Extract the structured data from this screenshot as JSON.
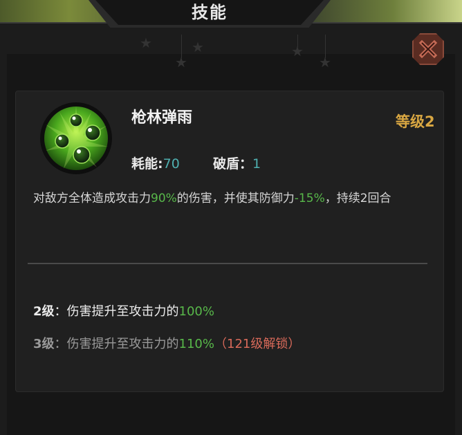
{
  "window": {
    "title": "技能"
  },
  "skill": {
    "name": "枪林弹雨",
    "level_label": "等级2",
    "energy_label": "耗能:",
    "energy_value": "70",
    "break_label": "破盾：",
    "break_value": "1",
    "icon": "green-droplets-icon",
    "description": {
      "part1": "对敌方全体造成攻击力",
      "highlight1": "90%",
      "part2": "的伤害，并使其防御力",
      "highlight2": "-15%",
      "part3": "，持续2回合"
    }
  },
  "upgrades": [
    {
      "level": "2级",
      "text": "：伤害提升至攻击力的",
      "value": "100%",
      "lock": ""
    },
    {
      "level": "3级",
      "text": "：伤害提升至攻击力的",
      "value": "110%",
      "lock": "（121级解锁）"
    }
  ],
  "colors": {
    "accent_gold": "#d9a742",
    "value_green": "#58b84a",
    "value_teal": "#4fb0b0",
    "lock_red": "#d96a5a"
  }
}
